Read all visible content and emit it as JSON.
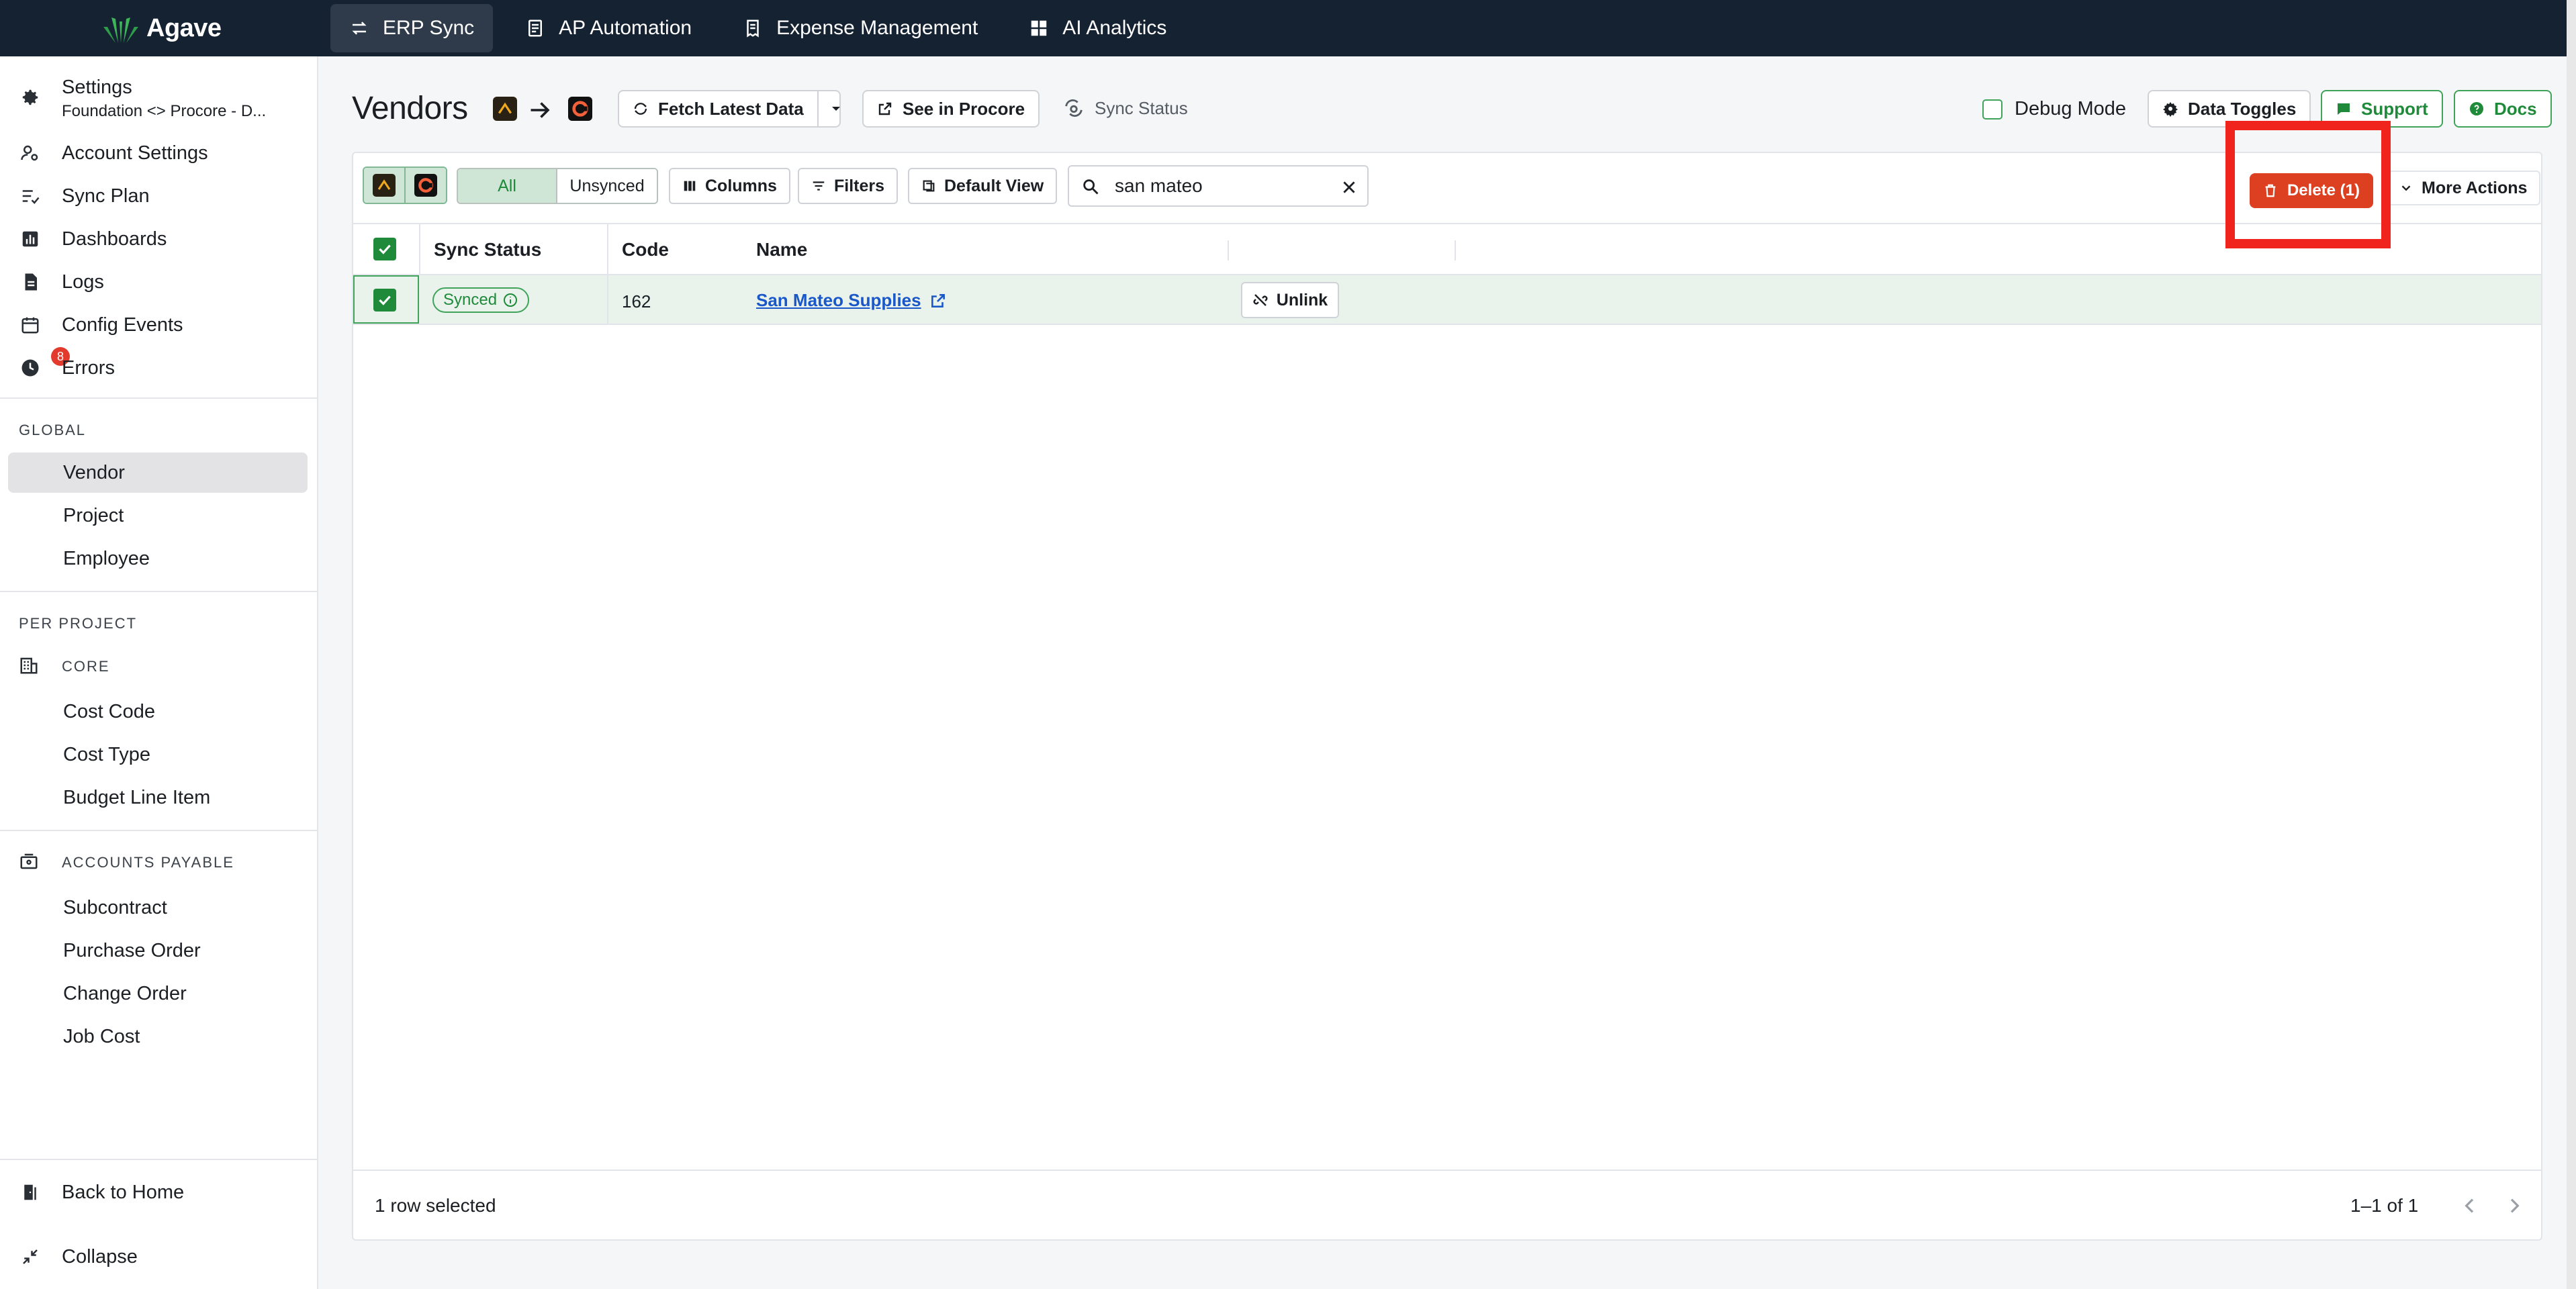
{
  "app": {
    "brand": "Agave",
    "top_nav": [
      {
        "label": "ERP Sync",
        "icon": "arrows-swap-icon",
        "active": true
      },
      {
        "label": "AP Automation",
        "icon": "invoice-icon",
        "active": false
      },
      {
        "label": "Expense Management",
        "icon": "receipt-icon",
        "active": false
      },
      {
        "label": "AI Analytics",
        "icon": "grid-icon",
        "active": false
      }
    ]
  },
  "sidebar": {
    "settings_label": "Settings",
    "settings_sub": "Foundation <> Procore - D...",
    "main_items": [
      {
        "label": "Account Settings",
        "icon": "user-gear-icon"
      },
      {
        "label": "Sync Plan",
        "icon": "checklist-icon"
      },
      {
        "label": "Dashboards",
        "icon": "bar-chart-icon"
      },
      {
        "label": "Logs",
        "icon": "document-icon"
      },
      {
        "label": "Config Events",
        "icon": "calendar-icon"
      },
      {
        "label": "Errors",
        "icon": "error-clock-icon",
        "badge": "8"
      }
    ],
    "global_label": "GLOBAL",
    "global_items": [
      "Vendor",
      "Project",
      "Employee"
    ],
    "active_item": "Vendor",
    "per_project_label": "PER PROJECT",
    "core_label": "CORE",
    "core_items": [
      "Cost Code",
      "Cost Type",
      "Budget Line Item"
    ],
    "ap_label": "ACCOUNTS PAYABLE",
    "ap_items": [
      "Subcontract",
      "Purchase Order",
      "Change Order",
      "Job Cost"
    ],
    "back_home": "Back to Home",
    "collapse": "Collapse"
  },
  "header": {
    "title": "Vendors",
    "fetch_label": "Fetch Latest Data",
    "see_in_label": "See in Procore",
    "sync_status_label": "Sync Status",
    "debug_label": "Debug Mode",
    "data_toggles_label": "Data Toggles",
    "support_label": "Support",
    "docs_label": "Docs"
  },
  "toolbar": {
    "filter_all": "All",
    "filter_unsynced": "Unsynced",
    "columns_label": "Columns",
    "filters_label": "Filters",
    "default_view_label": "Default View",
    "search_value": "san mateo",
    "delete_label": "Delete (1)",
    "more_actions_label": "More Actions"
  },
  "table": {
    "columns": [
      "Sync Status",
      "Code",
      "Name"
    ],
    "rows": [
      {
        "status": "Synced",
        "code": "162",
        "name": "San Mateo Supplies",
        "action": "Unlink",
        "selected": true
      }
    ]
  },
  "footer": {
    "selection_text": "1 row selected",
    "pagination": "1–1 of 1"
  },
  "colors": {
    "topbar": "#152232",
    "accent_green": "#1f8a3a",
    "danger": "#dd4020",
    "highlight_box": "#f0231d"
  }
}
